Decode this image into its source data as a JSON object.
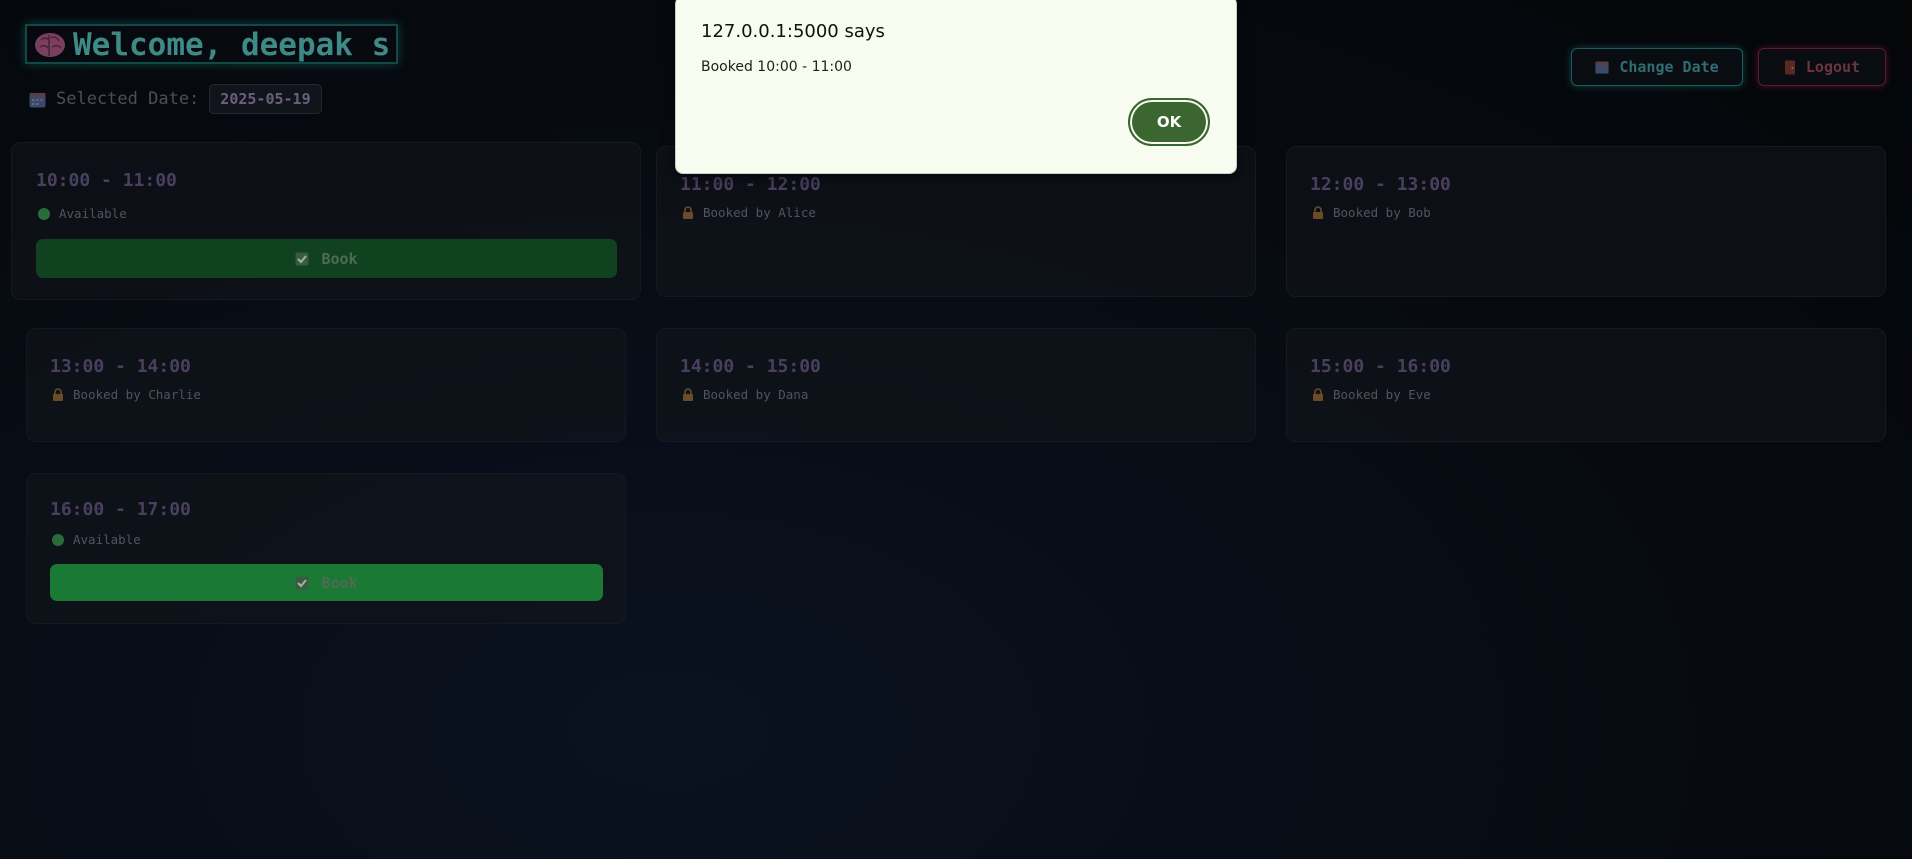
{
  "header": {
    "welcome_text": "Welcome, deepak s",
    "date_label": "Selected Date:",
    "selected_date": "2025-05-19",
    "change_date_label": "Change Date",
    "logout_label": "Logout"
  },
  "slots": [
    {
      "time": "10:00 - 11:00",
      "status": "Available",
      "available": true,
      "book_label": "Book"
    },
    {
      "time": "11:00 - 12:00",
      "status": "Booked by Alice",
      "available": false
    },
    {
      "time": "12:00 - 13:00",
      "status": "Booked by Bob",
      "available": false
    },
    {
      "time": "13:00 - 14:00",
      "status": "Booked by Charlie",
      "available": false
    },
    {
      "time": "14:00 - 15:00",
      "status": "Booked by Dana",
      "available": false
    },
    {
      "time": "15:00 - 16:00",
      "status": "Booked by Eve",
      "available": false
    },
    {
      "time": "16:00 - 17:00",
      "status": "Available",
      "available": true,
      "book_label": "Book"
    }
  ],
  "dialog": {
    "title": "127.0.0.1:5000 says",
    "message": "Booked 10:00 - 11:00",
    "ok_label": "OK"
  },
  "colors": {
    "accent_teal": "#3f8a86",
    "logout_red": "#6a3442",
    "book_green": "#1a7a35",
    "dialog_ok": "#3b662f"
  },
  "icons": {
    "welcome": "brain-icon",
    "date": "calendar-icon",
    "change_date": "calendar-icon",
    "logout": "door-icon",
    "available": "green-circle-icon",
    "booked": "lock-icon",
    "book": "checkbox-icon"
  }
}
